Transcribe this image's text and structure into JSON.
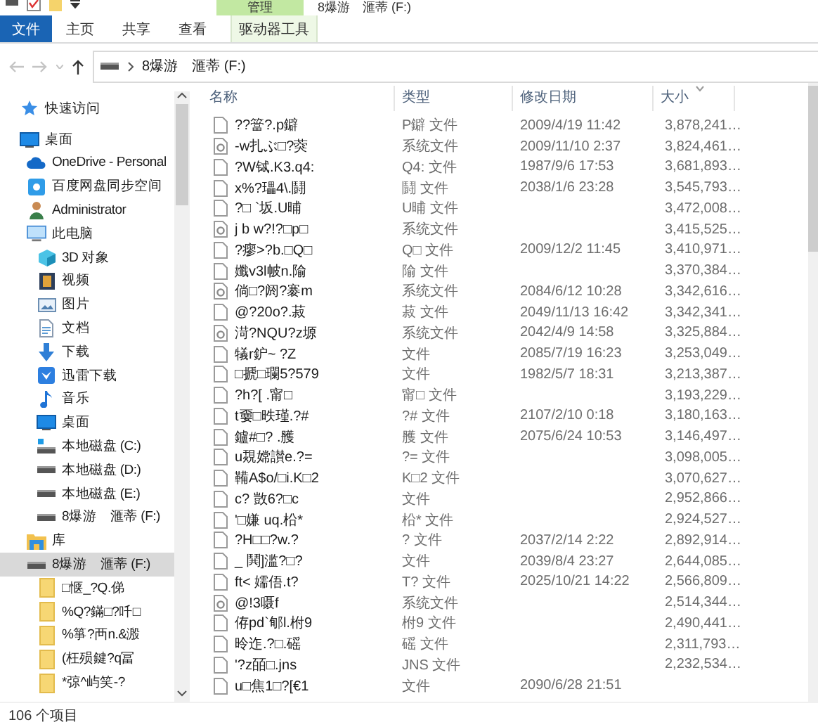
{
  "window": {
    "title": "8爆游　滙蒂 (F:)"
  },
  "ribbon": {
    "context_group": "管理",
    "tabs": [
      {
        "label": "文件",
        "kind": "file"
      },
      {
        "label": "主页",
        "kind": "normal"
      },
      {
        "label": "共享",
        "kind": "normal"
      },
      {
        "label": "查看",
        "kind": "normal"
      },
      {
        "label": "驱动器工具",
        "kind": "context"
      }
    ]
  },
  "address": {
    "back": {
      "disabled": true
    },
    "forward": {
      "disabled": true
    },
    "path": "8爆游　滙蒂 (F:)"
  },
  "nav": {
    "items": [
      {
        "label": "快速访问",
        "kind": "star",
        "selected": false
      },
      {
        "label": "桌面",
        "kind": "desktop",
        "selected": false,
        "children": [
          {
            "label": "OneDrive - Personal",
            "kind": "cloud",
            "selected": false
          },
          {
            "label": "百度网盘同步空间",
            "kind": "netdisk",
            "selected": false
          },
          {
            "label": "Administrator",
            "kind": "user",
            "selected": false
          },
          {
            "label": "此电脑",
            "kind": "pc",
            "selected": false,
            "children": [
              {
                "label": "3D 对象",
                "kind": "cube",
                "selected": false
              },
              {
                "label": "视频",
                "kind": "video",
                "selected": false
              },
              {
                "label": "图片",
                "kind": "picture",
                "selected": false
              },
              {
                "label": "文档",
                "kind": "document",
                "selected": false
              },
              {
                "label": "下载",
                "kind": "download",
                "selected": false
              },
              {
                "label": "迅雷下载",
                "kind": "thunder",
                "selected": false
              },
              {
                "label": "音乐",
                "kind": "music",
                "selected": false
              },
              {
                "label": "桌面",
                "kind": "desktop",
                "selected": false
              },
              {
                "label": "本地磁盘 (C:)",
                "kind": "sysdrive",
                "selected": false
              },
              {
                "label": "本地磁盘 (D:)",
                "kind": "drive",
                "selected": false
              },
              {
                "label": "本地磁盘 (E:)",
                "kind": "drive",
                "selected": false
              },
              {
                "label": "8爆游　滙蒂 (F:)",
                "kind": "drive",
                "selected": false
              }
            ]
          },
          {
            "label": "库",
            "kind": "library",
            "selected": false
          },
          {
            "label": "8爆游　滙蒂 (F:)",
            "kind": "drive",
            "selected": true,
            "children": [
              {
                "label": "□惬_?Q.俤",
                "kind": "folder",
                "selected": false
              },
              {
                "label": "%Q?鏋□?吀□",
                "kind": "folder",
                "selected": false
              },
              {
                "label": "%箏?襾n.&溵",
                "kind": "folder",
                "selected": false
              },
              {
                "label": "(枉殒鍵?q冨",
                "kind": "folder",
                "selected": false
              },
              {
                "label": "*弶^屿笑-?",
                "kind": "folder",
                "selected": false
              }
            ]
          }
        ]
      }
    ]
  },
  "file_list": {
    "columns": [
      {
        "label": "名称",
        "sorted": false
      },
      {
        "label": "类型",
        "sorted": false
      },
      {
        "label": "修改日期",
        "sorted": false
      },
      {
        "label": "大小",
        "sorted": true
      }
    ],
    "rows": [
      {
        "kind": "file",
        "name": "??簹?.p鐴",
        "type": "P鐴 文件",
        "modified": "2009/4/19 11:42",
        "size": "3,878,241…"
      },
      {
        "kind": "system",
        "name": "-w扎ぶ□?葖",
        "type": "系统文件",
        "modified": "2009/11/10 2:37",
        "size": "3,824,461…"
      },
      {
        "kind": "file",
        "name": "?W铽.K3.q4:",
        "type": "Q4: 文件",
        "modified": "1987/9/6 17:53",
        "size": "3,681,893…"
      },
      {
        "kind": "file",
        "name": "x%?瓃4\\.鬪",
        "type": "鬪 文件",
        "modified": "2038/1/6 23:28",
        "size": "3,545,793…"
      },
      {
        "kind": "file",
        "name": "?□  `坂.U晡",
        "type": "U晡 文件",
        "size": "3,472,008…"
      },
      {
        "kind": "system",
        "name": "j b w?!?□p□",
        "type": "系统文件",
        "size": "3,415,525…"
      },
      {
        "kind": "file",
        "name": "?瘳>?b.□Q□",
        "type": "Q□ 文件",
        "modified": "2009/12/2 11:45",
        "size": "3,410,971…"
      },
      {
        "kind": "file",
        "name": "孅v3l帔n.隃",
        "type": "隃 文件",
        "size": "3,370,384…"
      },
      {
        "kind": "system",
        "name": "倘□?阏?褰m",
        "type": "系统文件",
        "modified": "2084/6/12 10:28",
        "size": "3,342,616…"
      },
      {
        "kind": "file",
        "name": "@?20o?.菽",
        "type": "菽 文件",
        "modified": "2049/11/13 16:42",
        "size": "3,342,341…"
      },
      {
        "kind": "system",
        "name": "渮?NQU?z塬",
        "type": "系统文件",
        "modified": "2042/4/9 14:58",
        "size": "3,325,884…"
      },
      {
        "kind": "file",
        "name": "犠r鈩~ ?Z",
        "type": "文件",
        "modified": "2085/7/19 16:23",
        "size": "3,253,049…"
      },
      {
        "kind": "file",
        "name": "□搋□瓓5?579",
        "type": "文件",
        "modified": "1982/5/7 18:31",
        "size": "3,213,387…"
      },
      {
        "kind": "file",
        "name": " ?h?[  .甯□",
        "type": "甯□ 文件",
        "size": "3,193,229…"
      },
      {
        "kind": "file",
        "name": "t嫑□昳瑾.?#",
        "type": "?# 文件",
        "modified": "2107/2/10 0:18",
        "size": "3,180,163…"
      },
      {
        "kind": "file",
        "name": " 鑪#□? .雘",
        "type": "雘 文件",
        "modified": "2075/6/24 10:53",
        "size": "3,146,497…"
      },
      {
        "kind": "file",
        "name": "u覝嫦讃e.?=",
        "type": "?= 文件",
        "size": "3,098,005…"
      },
      {
        "kind": "file",
        "name": "鞴A$o/□i.K□2",
        "type": "K□2 文件",
        "size": "3,070,627…"
      },
      {
        "kind": "file",
        "name": "c? 敳6?□c",
        "type": "文件",
        "size": "2,952,866…"
      },
      {
        "kind": "file",
        "name": "'□嫌   uq.柗*",
        "type": "柗* 文件",
        "size": "2,924,527…"
      },
      {
        "kind": "file",
        "name": "?H□□?w.?",
        "type": "? 文件",
        "modified": "2037/2/14 2:22",
        "size": "2,892,914…"
      },
      {
        "kind": "file",
        "name": "_   鬨]滥?□?",
        "type": "文件",
        "modified": "2039/8/4 23:27",
        "size": "2,644,085…"
      },
      {
        "kind": "file",
        "name": "ft< 嬬俉.t?",
        "type": "T? 文件",
        "modified": "2025/10/21 14:22",
        "size": "2,566,809…"
      },
      {
        "kind": "system",
        "name": "@!3嗫f",
        "type": "系统文件",
        "size": "2,514,344…"
      },
      {
        "kind": "file",
        "name": "侟pd`郇l.柎9",
        "type": "柎9 文件",
        "size": "2,490,441…"
      },
      {
        "kind": "file",
        "name": "昤迮.?□.磘",
        "type": "磘 文件",
        "size": "2,311,793…"
      },
      {
        "kind": "file",
        "name": "'?z皕□.jns",
        "type": "JNS 文件",
        "size": "2,232,534…"
      },
      {
        "kind": "file",
        "name": "u□焦1□?[€1",
        "type": "文件",
        "modified": "2090/6/28 21:51"
      }
    ]
  },
  "status_bar": {
    "count": "106 个项目"
  }
}
